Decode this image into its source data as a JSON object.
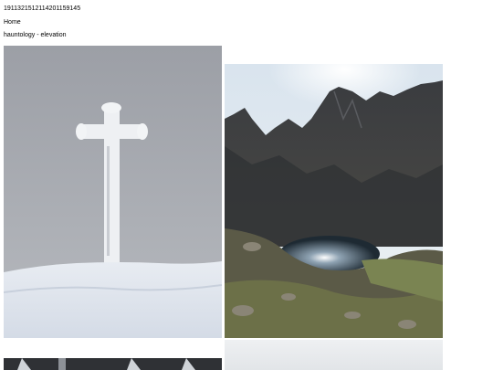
{
  "header": {
    "post_id": "1911321512114201159145",
    "home_link": "Home",
    "tag_link": "hauntology - elevation"
  },
  "gallery": {
    "photos": [
      {
        "subject": "snow-covered summit cross"
      },
      {
        "subject": "alpine lake between rocky mountains"
      },
      {
        "subject": "dark mountain ridge with snow patches"
      },
      {
        "subject": "pale overcast sky"
      }
    ]
  },
  "colors": {
    "page_background": "#ffffff",
    "text": "#000000"
  }
}
